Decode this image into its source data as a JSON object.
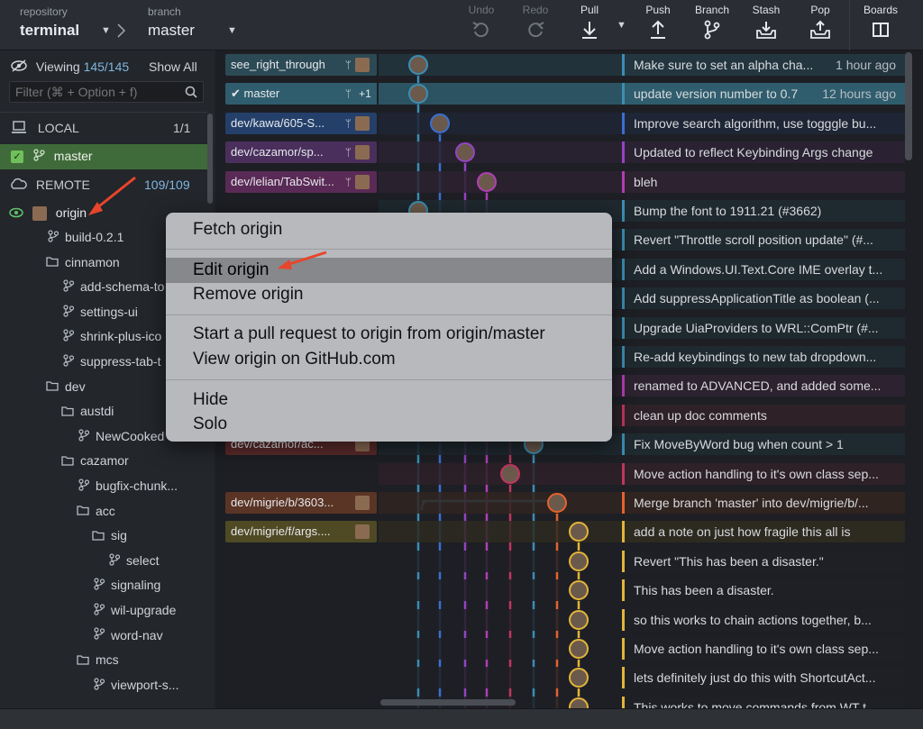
{
  "toolbar": {
    "repository_label": "repository",
    "repository": "terminal",
    "branch_label": "branch",
    "branch": "master",
    "undo": "Undo",
    "redo": "Redo",
    "pull": "Pull",
    "push": "Push",
    "branch_btn": "Branch",
    "stash": "Stash",
    "pop": "Pop",
    "boards": "Boards"
  },
  "sidebar": {
    "viewing_label": "Viewing",
    "viewing_count": "145/145",
    "show_all": "Show All",
    "filter_placeholder": "Filter (⌘ + Option + f)",
    "local_label": "LOCAL",
    "local_count": "1/1",
    "local_branch": "master",
    "remote_label": "REMOTE",
    "remote_count": "109/109",
    "remote_name": "origin",
    "tree": [
      {
        "label": "build-0.2.1",
        "type": "branch",
        "level": 1
      },
      {
        "label": "cinnamon",
        "type": "folder",
        "level": 1
      },
      {
        "label": "add-schema-to",
        "type": "branch",
        "level": 2
      },
      {
        "label": "settings-ui",
        "type": "branch",
        "level": 2
      },
      {
        "label": "shrink-plus-ico",
        "type": "branch",
        "level": 2
      },
      {
        "label": "suppress-tab-t",
        "type": "branch",
        "level": 2
      },
      {
        "label": "dev",
        "type": "folder",
        "level": 1
      },
      {
        "label": "austdi",
        "type": "folder",
        "level": 2
      },
      {
        "label": "NewCooked",
        "type": "branch",
        "level": 3
      },
      {
        "label": "cazamor",
        "type": "folder",
        "level": 2
      },
      {
        "label": "bugfix-chunk...",
        "type": "branch",
        "level": 3
      },
      {
        "label": "acc",
        "type": "folder",
        "level": 3
      },
      {
        "label": "sig",
        "type": "folder",
        "level": 4
      },
      {
        "label": "select",
        "type": "branch",
        "level": 5
      },
      {
        "label": "signaling",
        "type": "branch",
        "level": 4
      },
      {
        "label": "wil-upgrade",
        "type": "branch",
        "level": 4
      },
      {
        "label": "word-nav",
        "type": "branch",
        "level": 4
      },
      {
        "label": "mcs",
        "type": "folder",
        "level": 3
      },
      {
        "label": "viewport-s...",
        "type": "branch",
        "level": 4
      }
    ]
  },
  "branch_labels": [
    {
      "text": "see_right_through",
      "row": 0,
      "color": "#2b4a55"
    },
    {
      "text": "master",
      "row": 1,
      "color": "#2f5d6d",
      "extra": "+1"
    },
    {
      "text": "dev/kawa/605-S...",
      "row": 2,
      "color": "#24406a"
    },
    {
      "text": "dev/cazamor/sp...",
      "row": 3,
      "color": "#4a2f5c"
    },
    {
      "text": "dev/lelian/TabSwit...",
      "row": 4,
      "color": "#5a2a56"
    },
    {
      "text": "dev/cazamor/ac...",
      "row": 13,
      "color": "#5a2a2a"
    },
    {
      "text": "dev/migrie/b/3603...",
      "row": 15,
      "color": "#5a3424"
    },
    {
      "text": "dev/migrie/f/args....",
      "row": 16,
      "color": "#4f4a24"
    }
  ],
  "commits": [
    {
      "msg": "Make sure to set an alpha cha...",
      "time": "1 hour ago",
      "color": "#3c8db3",
      "bg": "#23363f"
    },
    {
      "msg": "update version number to 0.7",
      "time": "12 hours ago",
      "color": "#3c8db3",
      "bg": "#2f5d6d"
    },
    {
      "msg": "Improve search algorithm, use togggle bu...",
      "time": "",
      "color": "#3b6fd1",
      "bg": "#1e2635"
    },
    {
      "msg": "Updated to reflect Keybinding Args change",
      "time": "",
      "color": "#9443c2",
      "bg": "#2a2233"
    },
    {
      "msg": "bleh",
      "time": "",
      "color": "#b13fb3",
      "bg": "#2d2230"
    },
    {
      "msg": "Bump the font to 1911.21 (#3662)",
      "time": "",
      "color": "#3c8db3",
      "bg": "#1f2a30"
    },
    {
      "msg": "Revert \"Throttle scroll position update\" (#...",
      "time": "",
      "color": "#3c8db3",
      "bg": "#1f2a30"
    },
    {
      "msg": "Add a Windows.UI.Text.Core IME overlay t...",
      "time": "",
      "color": "#3c8db3",
      "bg": "#1f2a30"
    },
    {
      "msg": "Add suppressApplicationTitle as boolean (...",
      "time": "",
      "color": "#3c8db3",
      "bg": "#1f2a30"
    },
    {
      "msg": "Upgrade UiaProviders to WRL::ComPtr (#...",
      "time": "",
      "color": "#3c8db3",
      "bg": "#1f2a30"
    },
    {
      "msg": "Re-add keybindings to new tab dropdown...",
      "time": "",
      "color": "#3c8db3",
      "bg": "#1f2a30"
    },
    {
      "msg": "renamed to ADVANCED, and added some...",
      "time": "",
      "color": "#b13fb3",
      "bg": "#2d2230"
    },
    {
      "msg": "clean up doc comments",
      "time": "",
      "color": "#c0365f",
      "bg": "#2e2128"
    },
    {
      "msg": "Fix MoveByWord bug when count > 1",
      "time": "",
      "color": "#3c8db3",
      "bg": "#1f2a30"
    },
    {
      "msg": "Move action handling to it's own class sep...",
      "time": "",
      "color": "#c0365f",
      "bg": "#2e2128"
    },
    {
      "msg": "Merge branch 'master' into dev/migrie/b/...",
      "time": "",
      "color": "#e4622e",
      "bg": "#302420"
    },
    {
      "msg": "add a note on just how fragile this all is",
      "time": "",
      "color": "#e2b43a",
      "bg": "#2d2a20"
    },
    {
      "msg": "Revert \"This has been a disaster.\"",
      "time": "",
      "color": "#e2b43a",
      "bg": "#1f2025"
    },
    {
      "msg": "This has been a disaster.",
      "time": "",
      "color": "#e2b43a",
      "bg": "#1f2025"
    },
    {
      "msg": "so this works to chain actions together, b...",
      "time": "",
      "color": "#e2b43a",
      "bg": "#1f2025"
    },
    {
      "msg": "Move action handling to it's own class sep...",
      "time": "",
      "color": "#e2b43a",
      "bg": "#1f2025"
    },
    {
      "msg": "lets definitely just do this with ShortcutAct...",
      "time": "",
      "color": "#e2b43a",
      "bg": "#1f2025"
    },
    {
      "msg": "This works to move commands from WT t...",
      "time": "",
      "color": "#e2b43a",
      "bg": "#1f2025"
    }
  ],
  "context_menu": {
    "items": [
      {
        "label": "Fetch origin",
        "group": 0
      },
      {
        "label": "Edit origin",
        "group": 1,
        "highlighted": true
      },
      {
        "label": "Remove origin",
        "group": 1
      },
      {
        "label": "Start a pull request to origin from origin/master",
        "group": 2
      },
      {
        "label": "View origin on GitHub.com",
        "group": 2
      },
      {
        "label": "Hide",
        "group": 3
      },
      {
        "label": "Solo",
        "group": 3
      }
    ]
  },
  "colors": {
    "annotation_arrow": "#e8452c",
    "local_branch_bg": "#3f6b3a",
    "accent": "#3c8db3"
  }
}
